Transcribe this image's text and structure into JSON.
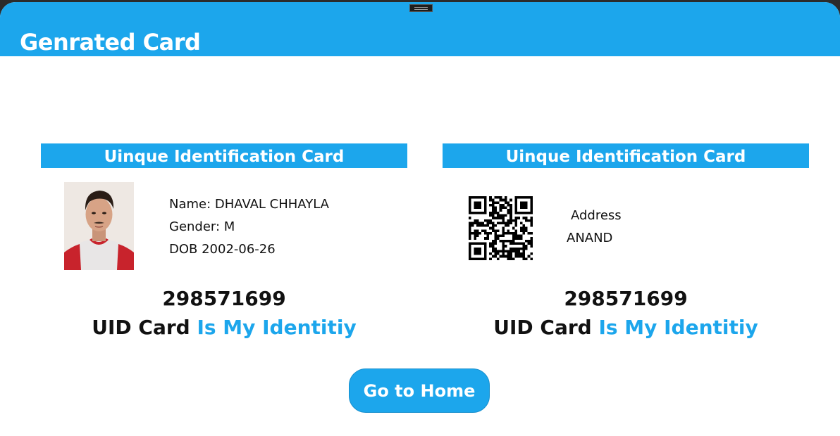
{
  "header": {
    "title": "Genrated Card"
  },
  "front_card": {
    "banner": "Uinque Identification Card",
    "name_line": "Name: DHAVAL CHHAYLA",
    "gender_line": "Gender: M",
    "dob_line": "DOB 2002-06-26",
    "uid_number": "298571699",
    "tagline_main": "UID Card ",
    "tagline_accent": "Is My Identitiy"
  },
  "back_card": {
    "banner": "Uinque Identification Card",
    "address_label": "Address",
    "address_value": "ANAND",
    "uid_number": "298571699",
    "tagline_main": "UID Card ",
    "tagline_accent": "Is My Identitiy"
  },
  "actions": {
    "home_label": "Go to Home"
  },
  "colors": {
    "accent": "#1ca6ec",
    "text": "#111111",
    "background": "#ffffff"
  },
  "icons": {
    "photo": "user-photo",
    "qr": "qr-code"
  }
}
